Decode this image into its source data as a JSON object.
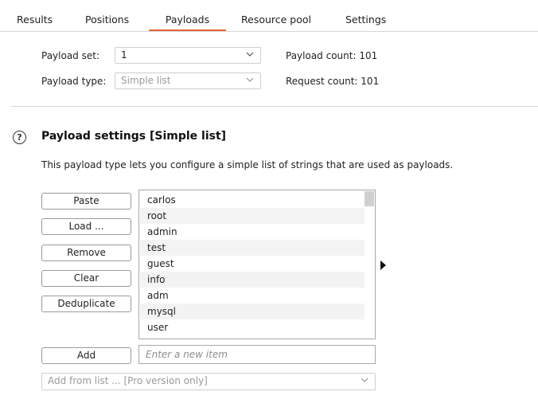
{
  "tabs": [
    {
      "label": "Results"
    },
    {
      "label": "Positions"
    },
    {
      "label": "Payloads",
      "active": true
    },
    {
      "label": "Resource pool"
    },
    {
      "label": "Settings"
    }
  ],
  "payload_set": {
    "label": "Payload set:",
    "value": "1"
  },
  "payload_type": {
    "label": "Payload type:",
    "value": "Simple list"
  },
  "payload_count": {
    "label": "Payload count:",
    "value": "101"
  },
  "request_count": {
    "label": "Request count:",
    "value": "101"
  },
  "settings": {
    "title": "Payload settings [Simple list]",
    "description": "This payload type lets you configure a simple list of strings that are used as payloads."
  },
  "buttons": {
    "paste": "Paste",
    "load": "Load ...",
    "remove": "Remove",
    "clear": "Clear",
    "deduplicate": "Deduplicate",
    "add": "Add"
  },
  "payload_list": [
    "carlos",
    "root",
    "admin",
    "test",
    "guest",
    "info",
    "adm",
    "mysql",
    "user"
  ],
  "new_item": {
    "value": "",
    "placeholder": "Enter a new item"
  },
  "add_from_list": {
    "value": "Add from list ... [Pro version only]"
  },
  "colors": {
    "accent": "#e8643a"
  },
  "icons": {
    "help": "help-circle-icon",
    "chevron": "chevron-down-icon",
    "arrow": "play-arrow-icon"
  }
}
